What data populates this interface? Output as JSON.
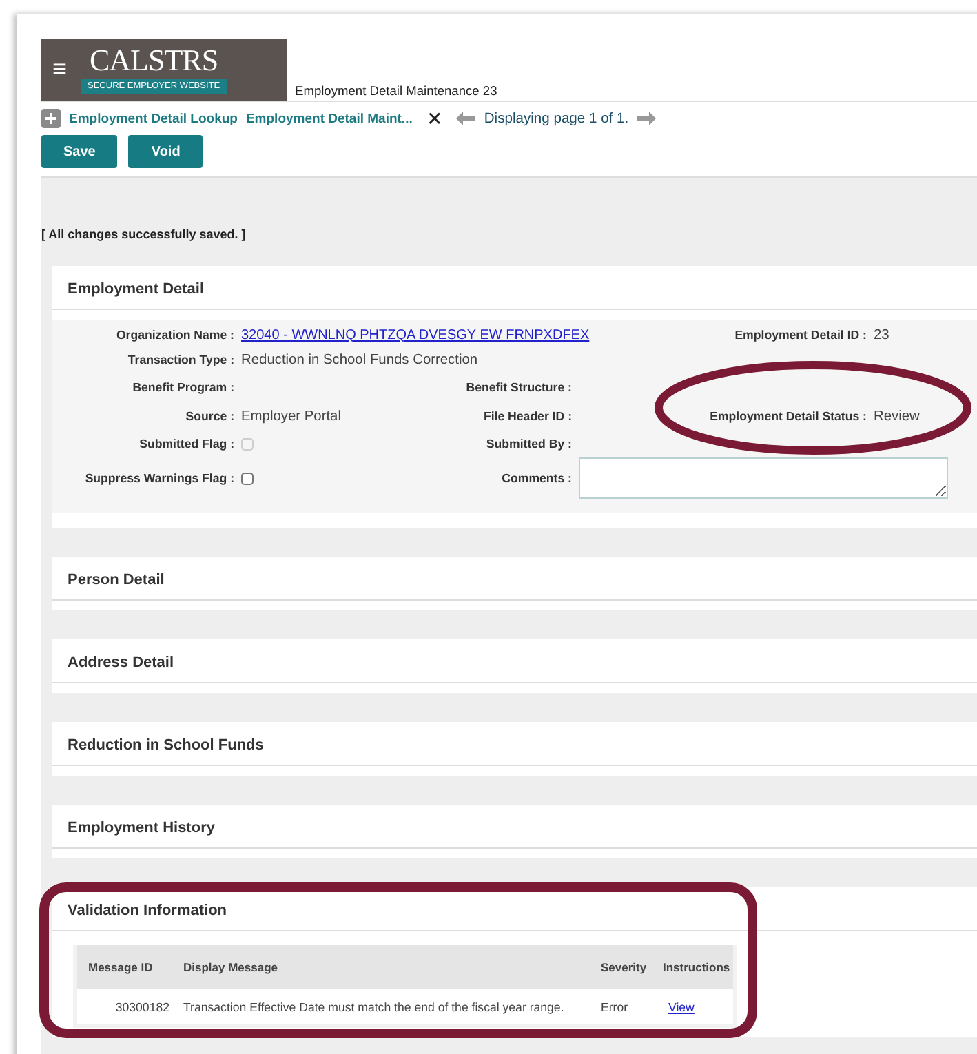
{
  "header": {
    "logo_name": "CALSTRS",
    "logo_tagline": "SECURE EMPLOYER WEBSITE",
    "menu_glyph": "≡",
    "page_title": "Employment Detail Maintenance 23"
  },
  "breadcrumbs": [
    "Employment Detail Lookup",
    "Employment Detail Maint..."
  ],
  "close_glyph": "✕",
  "paging": {
    "text": "Displaying page 1 of 1."
  },
  "buttons": [
    "Save",
    "Void"
  ],
  "message": "[ All changes successfully saved. ]",
  "detail": {
    "title": "Employment Detail",
    "rows": [
      [
        {
          "label": "Organization Name :",
          "kind": "link",
          "value": "32040 - WWNLNQ PHTZQA DVESGY EW FRNPXDFEX"
        },
        "",
        {
          "label": "Employment Detail ID :",
          "kind": "text",
          "value": "23"
        }
      ],
      [
        {
          "label": "Transaction Type :",
          "kind": "text",
          "value": "Reduction in School Funds Correction"
        }
      ],
      [
        {
          "label": "Benefit Program :",
          "kind": "text"
        },
        {
          "label": "Benefit Structure :",
          "kind": "text"
        }
      ],
      [
        {
          "label": "Source :",
          "kind": "text",
          "value": "Employer Portal"
        },
        {
          "label": "File Header ID :",
          "kind": "text"
        },
        {
          "label": "Employment Detail Status :",
          "kind": "text",
          "value": "Review"
        }
      ],
      [
        {
          "label": "Submitted Flag :",
          "kind": "checkbox",
          "checked": false,
          "disabled": true
        },
        {
          "label": "Submitted By :",
          "kind": "text"
        }
      ],
      [
        {
          "label": "Suppress Warnings Flag :",
          "kind": "checkbox",
          "checked": false,
          "disabled": false
        },
        {
          "label": "Comments :",
          "kind": "textarea"
        }
      ]
    ]
  },
  "sections": [
    "Person Detail",
    "Address Detail",
    "Reduction in School Funds",
    "Employment History"
  ],
  "validation": {
    "title": "Validation Information",
    "columns": [
      "Message ID",
      "Display Message",
      "Severity",
      "Instructions"
    ],
    "rows": [
      {
        "message_id": "30300182",
        "display_message": "Transaction Effective Date must match the end of the fiscal year range.",
        "severity": "Error",
        "instructions": "View"
      }
    ]
  },
  "annotations": {
    "status_ellipse": true,
    "validation_frame": true
  }
}
